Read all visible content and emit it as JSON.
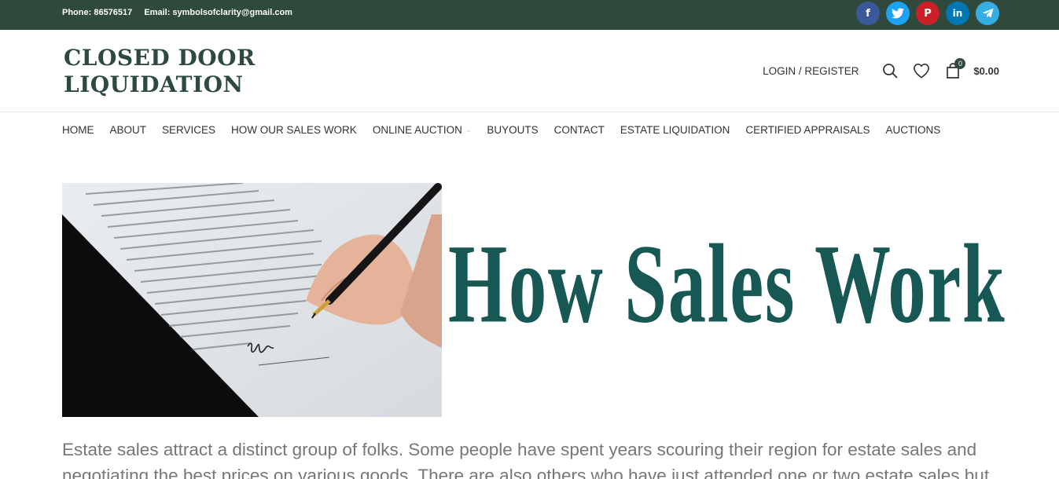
{
  "topbar": {
    "phone": "Phone: 86576517",
    "email": "Email: symbolsofclarity@gmail.com",
    "socials": [
      {
        "icon": "facebook-icon",
        "glyph": "f",
        "color": "#3b5998"
      },
      {
        "icon": "twitter-icon",
        "glyph": "🐦",
        "color": "#1da1f2"
      },
      {
        "icon": "pinterest-icon",
        "glyph": "P",
        "color": "#cb2027"
      },
      {
        "icon": "linkedin-icon",
        "glyph": "in",
        "color": "#0077b5"
      },
      {
        "icon": "telegram-icon",
        "glyph": "➤",
        "color": "#37aee2"
      }
    ]
  },
  "header": {
    "logo_line1": "CLOSED DOOR",
    "logo_line2": "LIQUIDATION",
    "login": "LOGIN / REGISTER",
    "cart_count": "0",
    "cart_total": "$0.00"
  },
  "nav": {
    "items": [
      "HOME",
      "ABOUT",
      "SERVICES",
      "HOW OUR SALES WORK",
      "ONLINE AUCTION",
      "BUYOUTS",
      "CONTACT",
      "ESTATE LIQUIDATION",
      "CERTIFIED APPRAISALS",
      "AUCTIONS"
    ]
  },
  "hero": {
    "title": "How Sales Work"
  },
  "content": {
    "intro": "Estate sales attract a distinct group of folks. Some people have spent years scouring their region for estate sales and negotiating the best prices on various goods. There are also others who have just attended one or two estate sales but"
  },
  "colors": {
    "topbar": "#2f4a3d",
    "logo": "#2d4a3c",
    "hero_title": "#175754"
  }
}
